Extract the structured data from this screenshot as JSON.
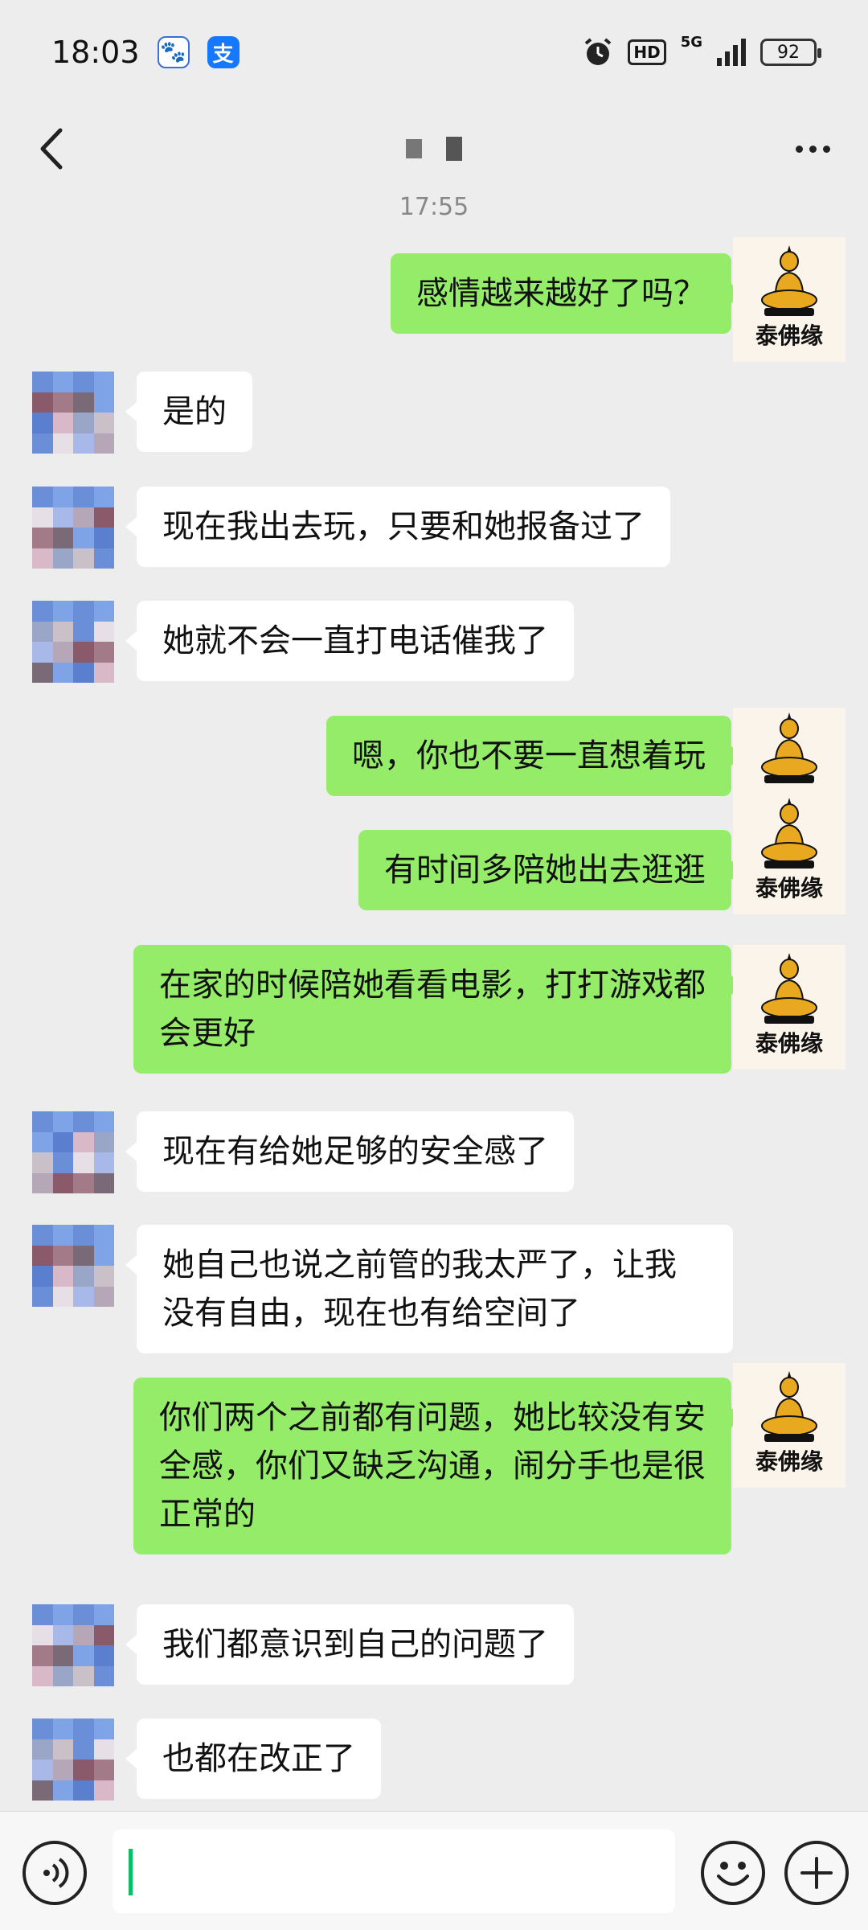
{
  "status_bar": {
    "time": "18:03",
    "network": "5G",
    "hd": "HD",
    "battery": "92"
  },
  "header": {
    "title_obscured": true
  },
  "chat": {
    "timestamp": "17:55",
    "self_avatar_label": "泰佛缘",
    "messages": [
      {
        "side": "out",
        "text": "感情越来越好了吗？"
      },
      {
        "side": "in",
        "text": "是的"
      },
      {
        "side": "in",
        "text": "现在我出去玩，只要和她报备过了"
      },
      {
        "side": "in",
        "text": "她就不会一直打电话催我了"
      },
      {
        "side": "out",
        "text": "嗯，你也不要一直想着玩"
      },
      {
        "side": "out",
        "text": "有时间多陪她出去逛逛"
      },
      {
        "side": "out",
        "text": "在家的时候陪她看看电影，打打游戏都会更好"
      },
      {
        "side": "in",
        "text": "现在有给她足够的安全感了"
      },
      {
        "side": "in",
        "text": "她自己也说之前管的我太严了，让我没有自由，现在也有给空间了"
      },
      {
        "side": "out",
        "text": "你们两个之前都有问题，她比较没有安全感，你们又缺乏沟通，闹分手也是很正常的"
      },
      {
        "side": "in",
        "text": "我们都意识到自己的问题了"
      },
      {
        "side": "in",
        "text": "也都在改正了"
      }
    ]
  },
  "input_bar": {
    "value": ""
  },
  "colors": {
    "background": "#ededed",
    "outgoing_bubble": "#95ec69",
    "incoming_bubble": "#ffffff",
    "caret": "#07c160"
  },
  "icons": [
    "back-arrow-icon",
    "more-icon",
    "voice-icon",
    "emoji-icon",
    "plus-icon",
    "alarm-icon",
    "signal-icon",
    "battery-icon"
  ]
}
